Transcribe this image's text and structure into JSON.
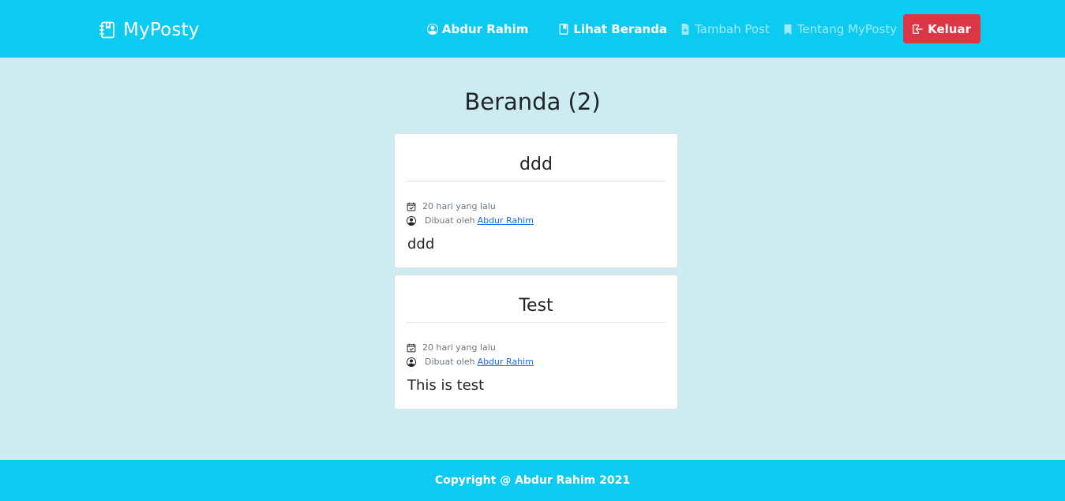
{
  "navbar": {
    "brand": {
      "icon": "notebook-icon",
      "text": "MyPosty"
    },
    "user": {
      "icon": "user-circle-icon",
      "label": "Abdur Rahim"
    },
    "links": [
      {
        "icon": "book-icon",
        "label": "Lihat Beranda"
      },
      {
        "icon": "file-plus-icon",
        "label": "Tambah Post"
      },
      {
        "icon": "bookmark-icon",
        "label": "Tentang MyPosty"
      }
    ],
    "logout": {
      "icon": "logout-icon",
      "label": "Keluar"
    }
  },
  "main": {
    "title": "Beranda (2)",
    "posts": [
      {
        "title": "ddd",
        "date": "20 hari yang lalu",
        "author_prefix": "Dibuat oleh",
        "author": "Abdur Rahim",
        "body": "ddd"
      },
      {
        "title": "Test",
        "date": "20 hari yang lalu",
        "author_prefix": "Dibuat oleh",
        "author": "Abdur Rahim",
        "body": "This is test"
      }
    ]
  },
  "footer": {
    "text": "Copyright @ Abdur Rahim 2021"
  },
  "colors": {
    "primary": "#0dcaf0",
    "background": "#cdecf1",
    "danger": "#dc3545",
    "link": "#0d6efd"
  }
}
